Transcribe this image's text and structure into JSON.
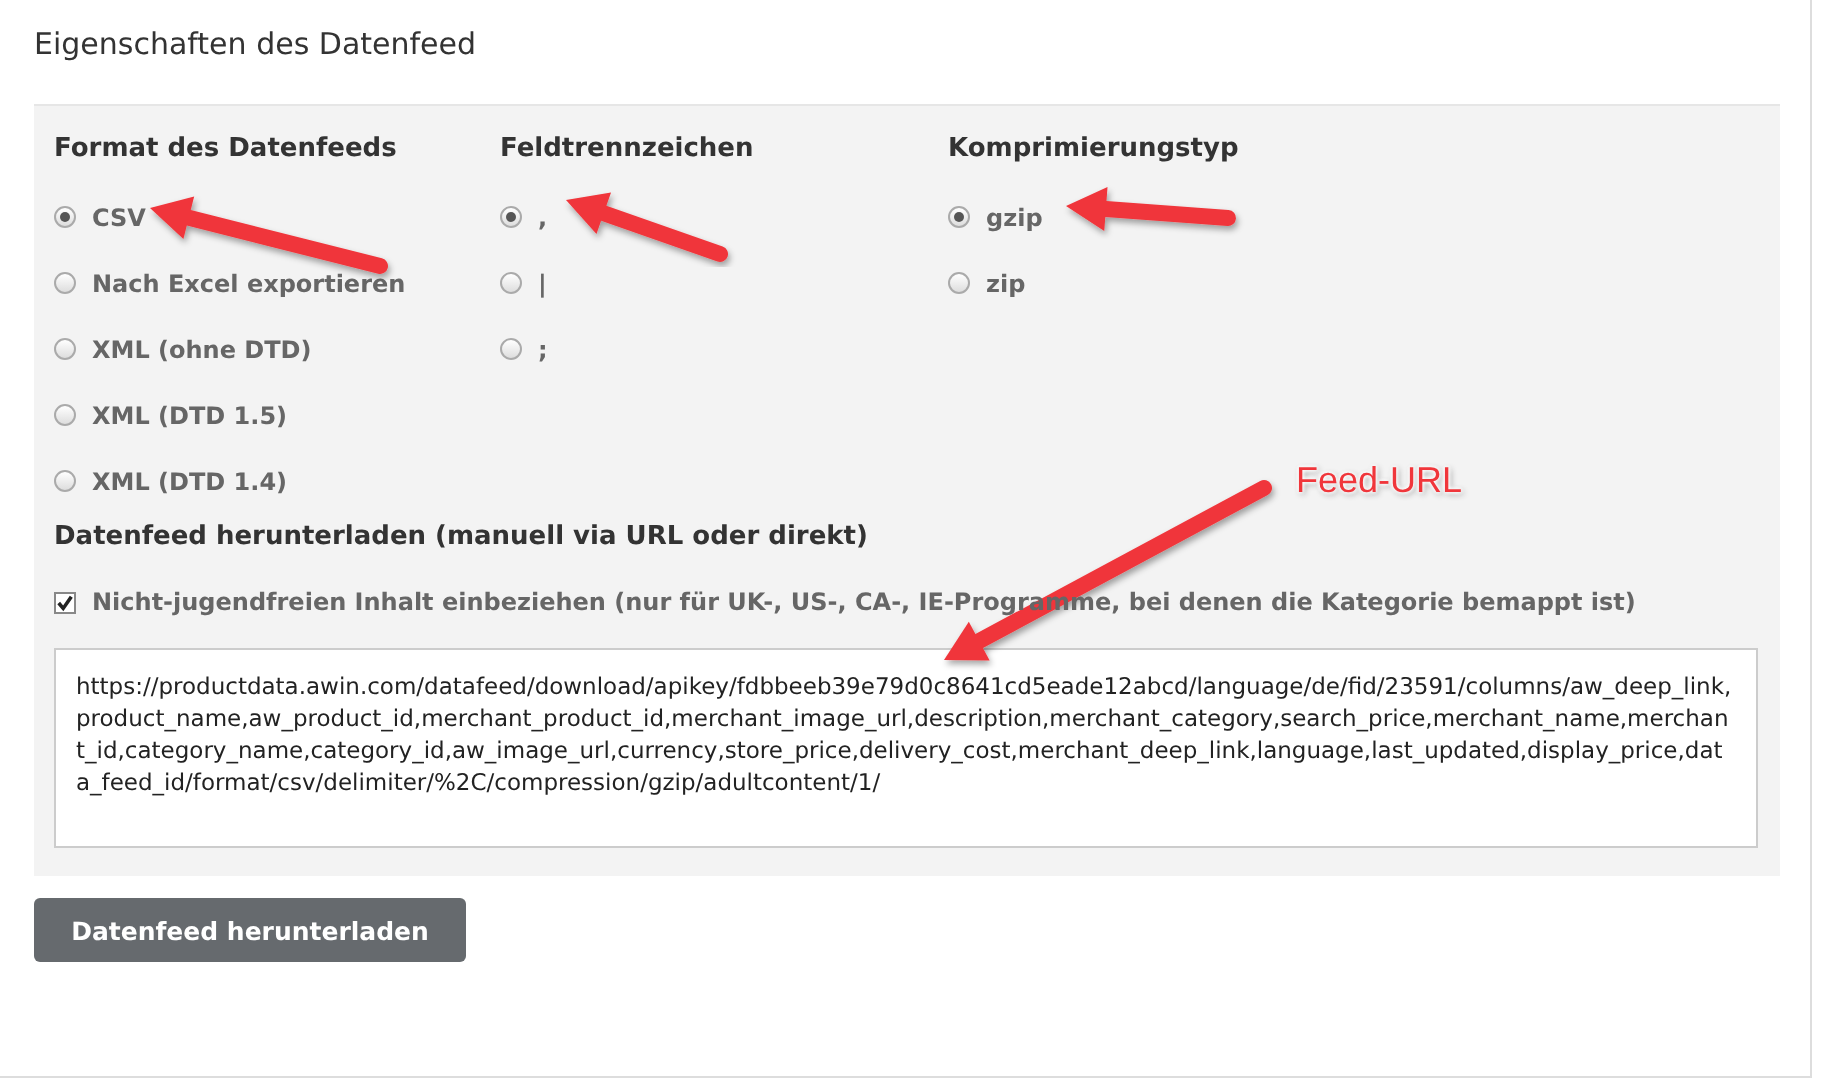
{
  "title": "Eigenschaften des Datenfeed",
  "groups": [
    {
      "heading": "Format des Datenfeeds",
      "options": [
        {
          "label": "CSV",
          "selected": true
        },
        {
          "label": "Nach Excel exportieren",
          "selected": false
        },
        {
          "label": "XML (ohne DTD)",
          "selected": false
        },
        {
          "label": "XML (DTD 1.5)",
          "selected": false
        },
        {
          "label": "XML (DTD 1.4)",
          "selected": false
        }
      ]
    },
    {
      "heading": "Feldtrennzeichen",
      "options": [
        {
          "label": ",",
          "selected": true
        },
        {
          "label": "|",
          "selected": false
        },
        {
          "label": ";",
          "selected": false
        }
      ]
    },
    {
      "heading": "Komprimierungstyp",
      "options": [
        {
          "label": "gzip",
          "selected": true
        },
        {
          "label": "zip",
          "selected": false
        }
      ]
    }
  ],
  "download": {
    "heading": "Datenfeed herunterladen (manuell via URL oder direkt)",
    "adult_content": {
      "label": "Nicht-jugendfreien Inhalt einbeziehen (nur für UK-, US-, CA-, IE-Programme, bei denen die Kategorie bemappt ist)",
      "checked": true
    },
    "url": "https://productdata.awin.com/datafeed/download/apikey/fdbbeeb39e79d0c8641cd5eade12abcd/language/de/fid/23591/columns/aw_deep_link,product_name,aw_product_id,merchant_product_id,merchant_image_url,description,merchant_category,search_price,merchant_name,merchant_id,category_name,category_id,aw_image_url,currency,store_price,delivery_cost,merchant_deep_link,language,last_updated,display_price,data_feed_id/format/csv/delimiter/%2C/compression/gzip/adultcontent/1/"
  },
  "button": "Datenfeed herunterladen",
  "annotation_label": "Feed-URL"
}
